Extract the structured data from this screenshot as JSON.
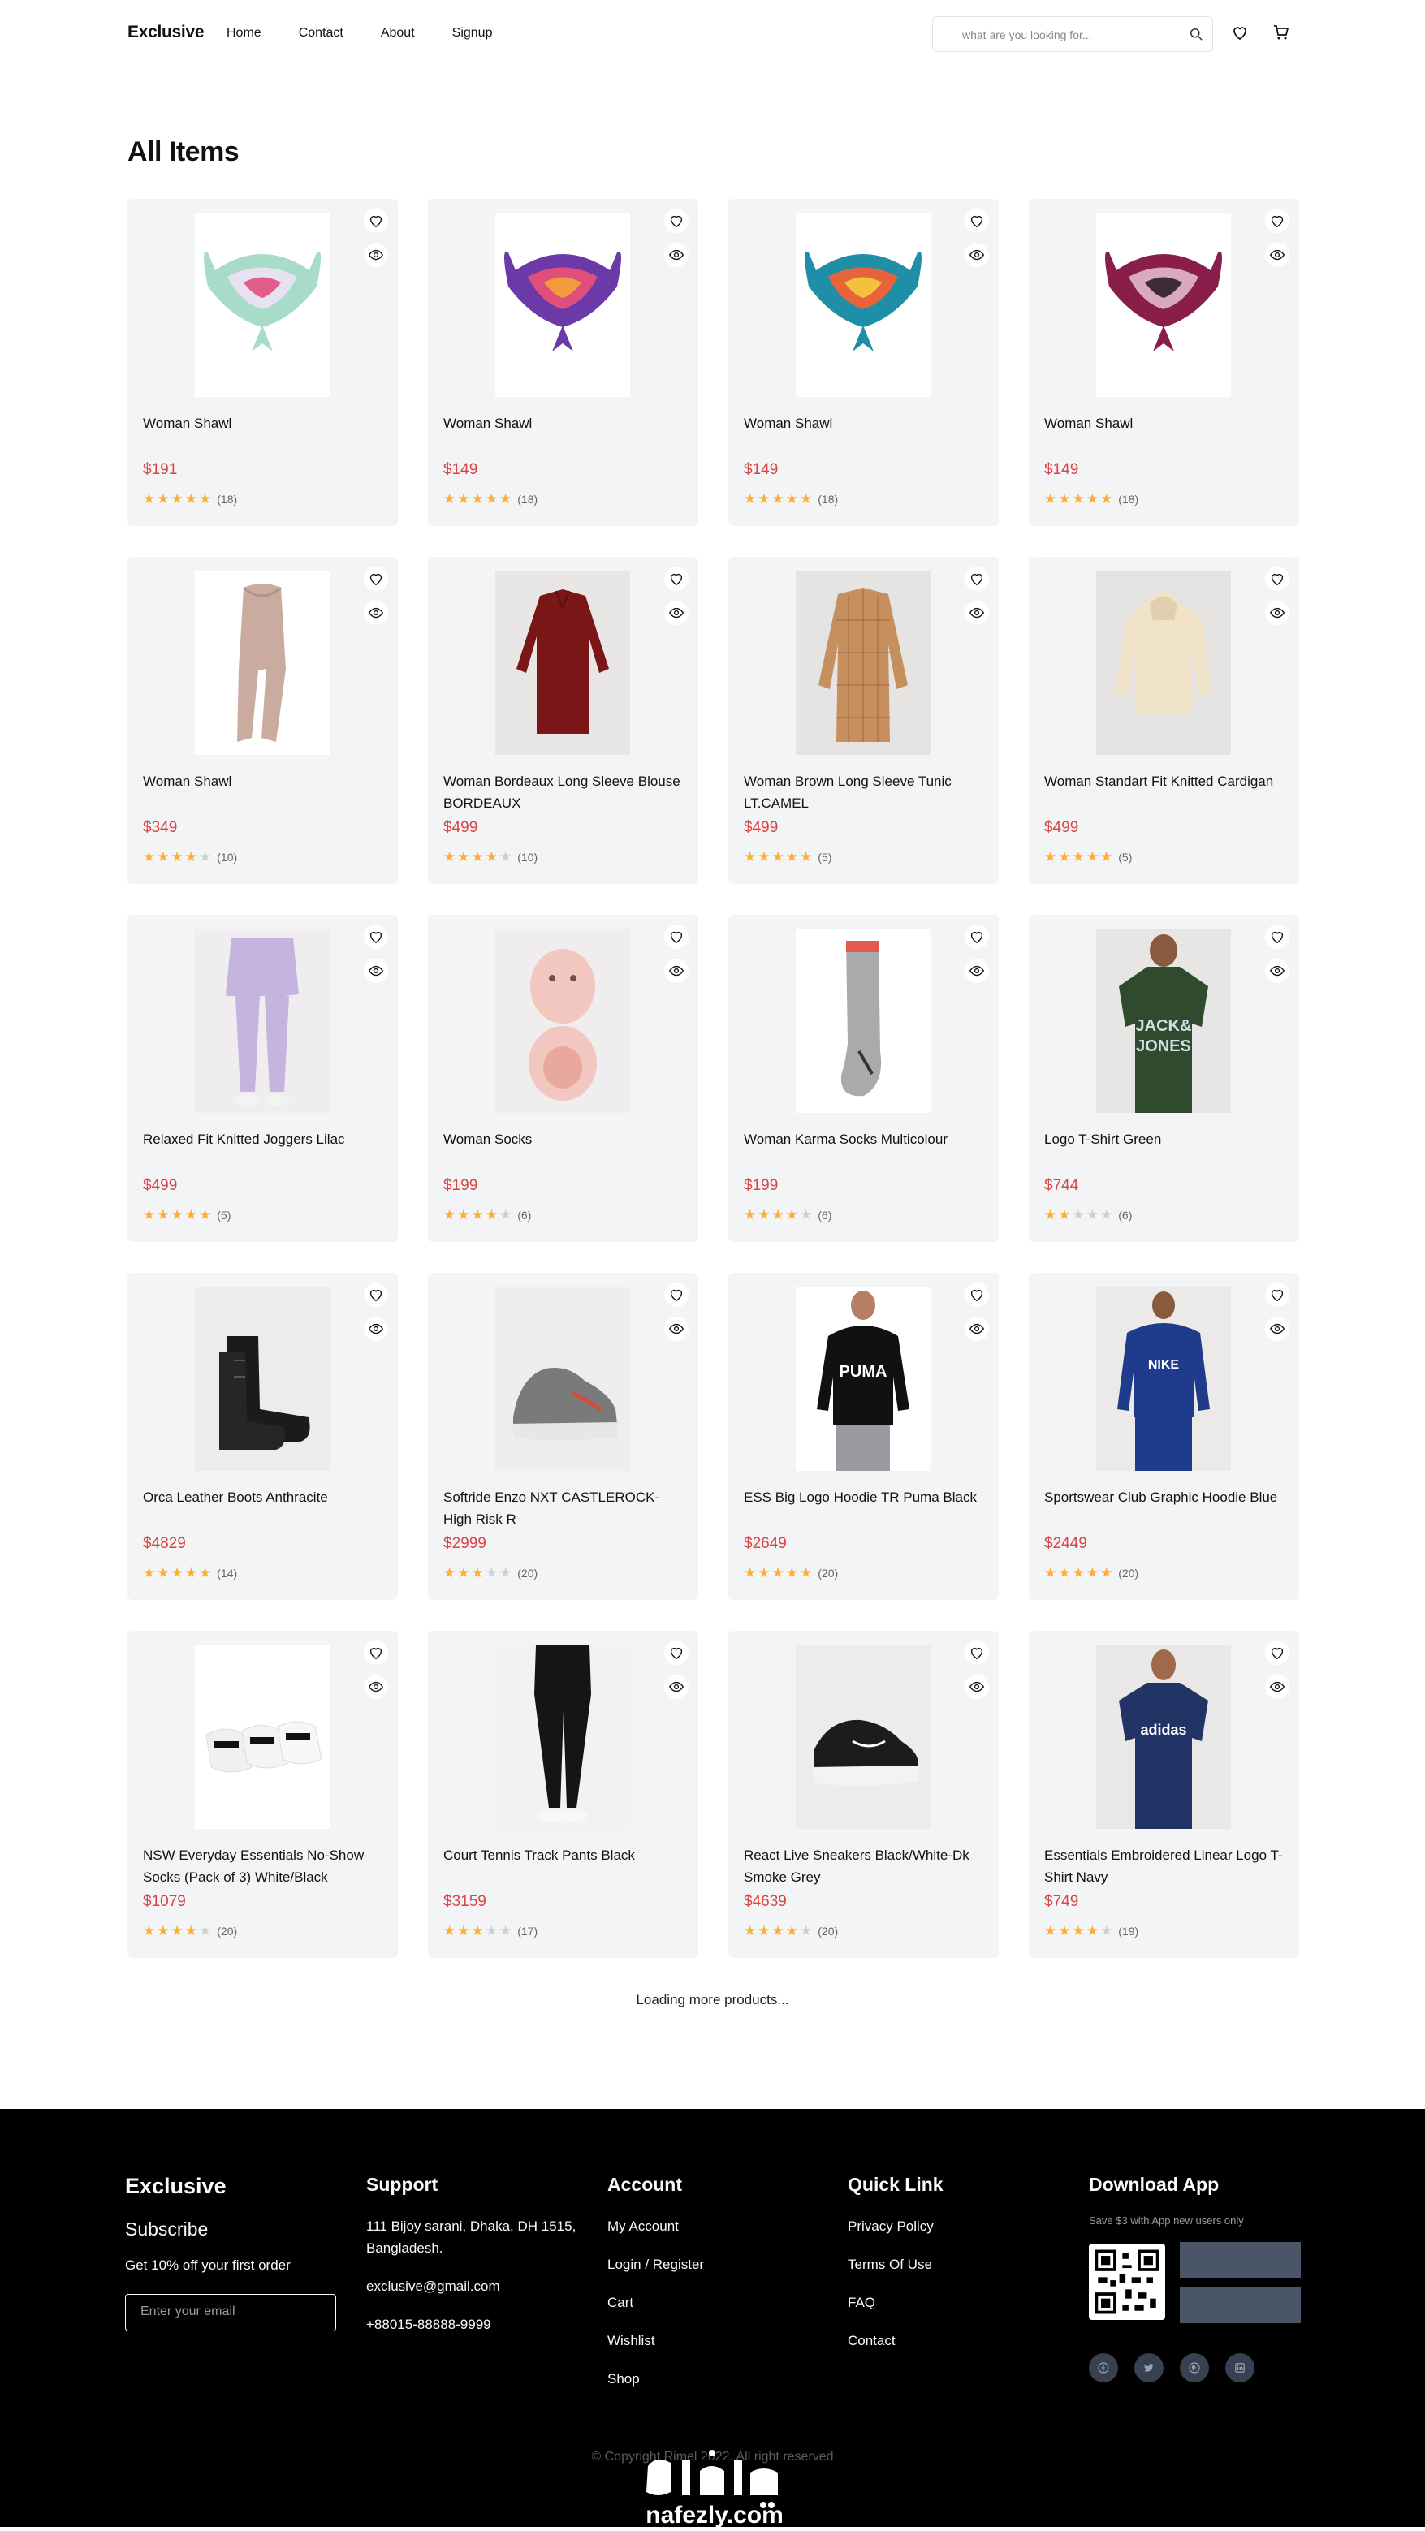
{
  "header": {
    "logo": "Exclusive",
    "nav": [
      "Home",
      "Contact",
      "About",
      "Signup"
    ],
    "search_placeholder": "what are you looking for..."
  },
  "main": {
    "title": "All Items",
    "loading_text": "Loading more products..."
  },
  "products": [
    {
      "name": "Woman Shawl",
      "price": "$191",
      "rating": 5,
      "count": "(18)",
      "image": "scarf-mint"
    },
    {
      "name": "Woman Shawl",
      "price": "$149",
      "rating": 5,
      "count": "(18)",
      "image": "scarf-purple"
    },
    {
      "name": "Woman Shawl",
      "price": "$149",
      "rating": 5,
      "count": "(18)",
      "image": "scarf-teal-orange"
    },
    {
      "name": "Woman Shawl",
      "price": "$149",
      "rating": 5,
      "count": "(18)",
      "image": "scarf-burgundy"
    },
    {
      "name": "Woman Shawl",
      "price": "$349",
      "rating": 4,
      "count": "(10)",
      "image": "scarf-beige"
    },
    {
      "name": "Woman Bordeaux Long Sleeve Blouse BORDEAUX",
      "price": "$499",
      "rating": 4,
      "count": "(10)",
      "image": "blouse-red"
    },
    {
      "name": "Woman Brown Long Sleeve Tunic LT.CAMEL",
      "price": "$499",
      "rating": 5,
      "count": "(5)",
      "image": "tunic-camel"
    },
    {
      "name": "Woman Standart Fit Knitted Cardigan",
      "price": "$499",
      "rating": 5,
      "count": "(5)",
      "image": "cardigan-cream"
    },
    {
      "name": "Relaxed Fit Knitted Joggers Lilac",
      "price": "$499",
      "rating": 5,
      "count": "(5)",
      "image": "joggers-lilac"
    },
    {
      "name": "Woman Socks",
      "price": "$199",
      "rating": 4,
      "count": "(6)",
      "image": "socks-pink"
    },
    {
      "name": "Woman Karma Socks Multicolour",
      "price": "$199",
      "rating": 4,
      "count": "(6)",
      "image": "socks-grey"
    },
    {
      "name": "Logo T-Shirt Green",
      "price": "$744",
      "rating": 2,
      "count": "(6)",
      "image": "tshirt-green"
    },
    {
      "name": "Orca Leather Boots Anthracite",
      "price": "$4829",
      "rating": 5,
      "count": "(14)",
      "image": "boots-black"
    },
    {
      "name": "Softride Enzo NXT CASTLEROCK-High Risk R",
      "price": "$2999",
      "rating": 3,
      "count": "(20)",
      "image": "sneaker-grey"
    },
    {
      "name": "ESS Big Logo Hoodie TR Puma Black",
      "price": "$2649",
      "rating": 5,
      "count": "(20)",
      "image": "hoodie-black"
    },
    {
      "name": "Sportswear Club Graphic Hoodie Blue",
      "price": "$2449",
      "rating": 5,
      "count": "(20)",
      "image": "hoodie-blue"
    },
    {
      "name": "NSW Everyday Essentials No-Show Socks (Pack of 3) White/Black",
      "price": "$1079",
      "rating": 4,
      "count": "(20)",
      "image": "socks-white"
    },
    {
      "name": "Court Tennis Track Pants Black",
      "price": "$3159",
      "rating": 3,
      "count": "(17)",
      "image": "pants-black"
    },
    {
      "name": "React Live Sneakers Black/White-Dk Smoke Grey",
      "price": "$4639",
      "rating": 4,
      "count": "(20)",
      "image": "sneaker-black"
    },
    {
      "name": "Essentials Embroidered Linear Logo T-Shirt Navy",
      "price": "$749",
      "rating": 4,
      "count": "(19)",
      "image": "tshirt-navy"
    }
  ],
  "footer": {
    "brand": "Exclusive",
    "subscribe": "Subscribe",
    "offer": "Get 10% off your first order",
    "email_placeholder": "Enter your email",
    "support": {
      "title": "Support",
      "address": "111 Bijoy sarani, Dhaka, DH 1515, Bangladesh.",
      "email": "exclusive@gmail.com",
      "phone": "+88015-88888-9999"
    },
    "account": {
      "title": "Account",
      "items": [
        "My Account",
        "Login / Register",
        "Cart",
        "Wishlist",
        "Shop"
      ]
    },
    "quick_link": {
      "title": "Quick Link",
      "items": [
        "Privacy Policy",
        "Terms Of Use",
        "FAQ",
        "Contact"
      ]
    },
    "download": {
      "title": "Download App",
      "note": "Save $3 with App new users only"
    },
    "social": [
      "facebook-icon",
      "twitter-icon",
      "instagram-icon",
      "linkedin-icon"
    ],
    "copyright": "© Copyright Rimel 2022. All right reserved",
    "watermark": "nafezly.com"
  },
  "colors": {
    "accent": "#db4444",
    "star": "#ffad33",
    "card_bg": "#f3f4f6",
    "footer_bg": "#000000"
  }
}
